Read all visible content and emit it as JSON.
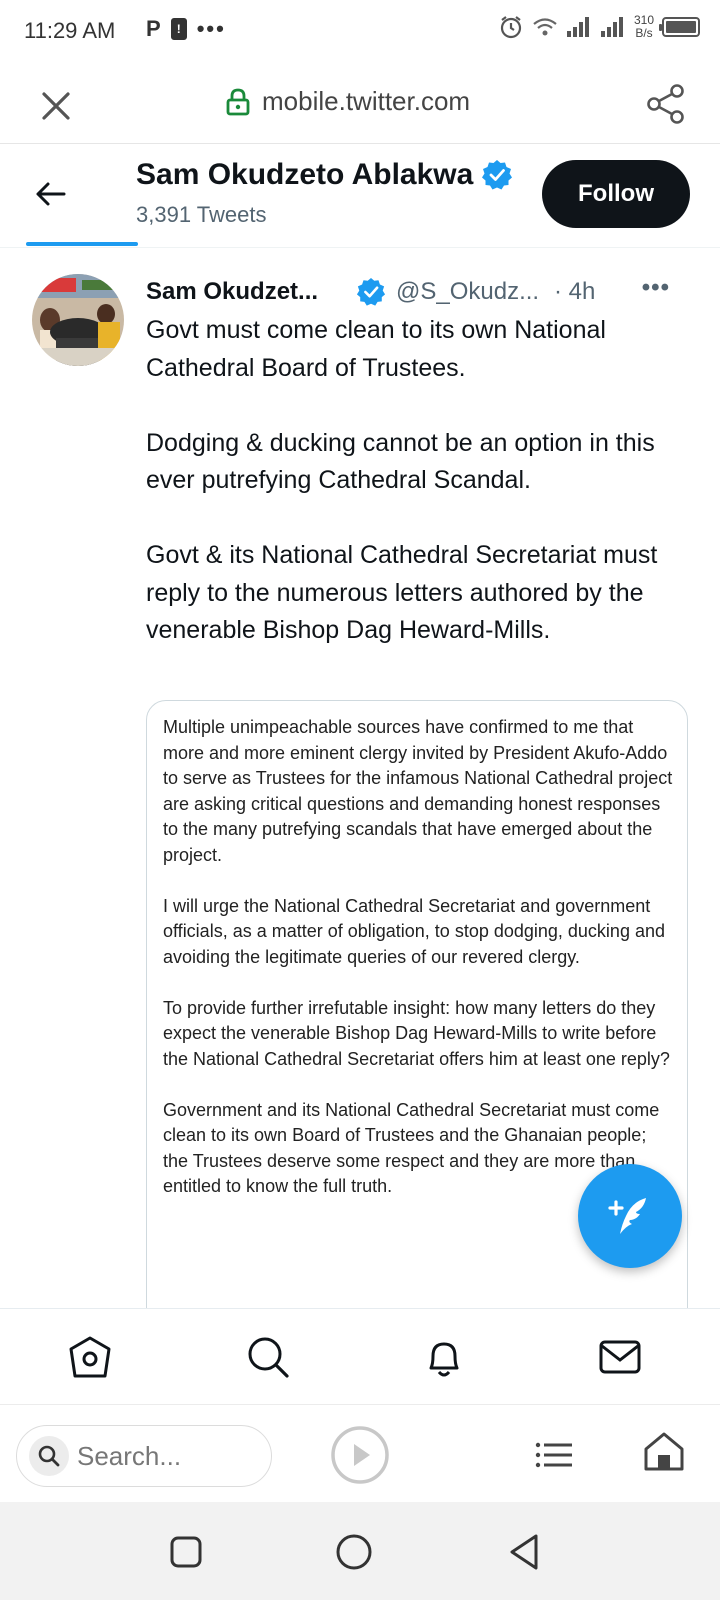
{
  "status_bar": {
    "time": "11:29 AM",
    "left_icons": [
      "parking-icon",
      "warning-icon",
      "more-dots-icon"
    ],
    "right_icons": [
      "alarm-icon",
      "wifi-icon",
      "signal-icon",
      "signal-icon",
      "battery-icon"
    ],
    "speed_value": "310",
    "speed_unit": "B/s"
  },
  "url_bar": {
    "url": "mobile.twitter.com",
    "lock_color": "#1a8a3a"
  },
  "profile_header": {
    "name": "Sam Okudzeto Ablakwa",
    "tweet_count": "3,391 Tweets",
    "follow_label": "Follow",
    "verified_color": "#1d9bf0"
  },
  "tweet": {
    "author_name": "Sam Okudzet...",
    "handle": "@S_Okudz...",
    "time": "· 4h",
    "more": "•••",
    "paragraphs": [
      "Govt must come clean to its own National Cathedral Board of Trustees.",
      "Dodging & ducking cannot be an option in this ever putrefying Cathedral Scandal.",
      "Govt & its National Cathedral Secretariat must reply to the numerous letters authored by the venerable Bishop Dag Heward-Mills."
    ],
    "quote_paragraphs": [
      "Multiple unimpeachable sources have confirmed to me that more and more eminent clergy invited by President Akufo-Addo to serve as Trustees for the infamous National Cathedral project are asking critical questions and demanding honest responses to the many putrefying scandals that have emerged about the project.",
      "I will urge the National Cathedral Secretariat and government officials, as a matter of obligation, to stop dodging, ducking and avoiding the legitimate queries of our revered clergy.",
      "To provide further irrefutable insight: how many letters do they expect the venerable Bishop Dag Heward-Mills to write before the National Cathedral Secretariat offers him at least one reply?",
      "Government and its National Cathedral Secretariat must come clean to its own Board of Trustees and the Ghanaian people; the Trustees deserve some respect and they are more than entitled to know the full truth."
    ]
  },
  "bottom_tabs": [
    "home-icon",
    "explore-icon",
    "notifications-icon",
    "messages-icon"
  ],
  "browser_bar": {
    "search_placeholder": "Search..."
  },
  "colors": {
    "accent": "#1d9bf0",
    "text_primary": "#0f1419",
    "text_secondary": "#536471"
  }
}
